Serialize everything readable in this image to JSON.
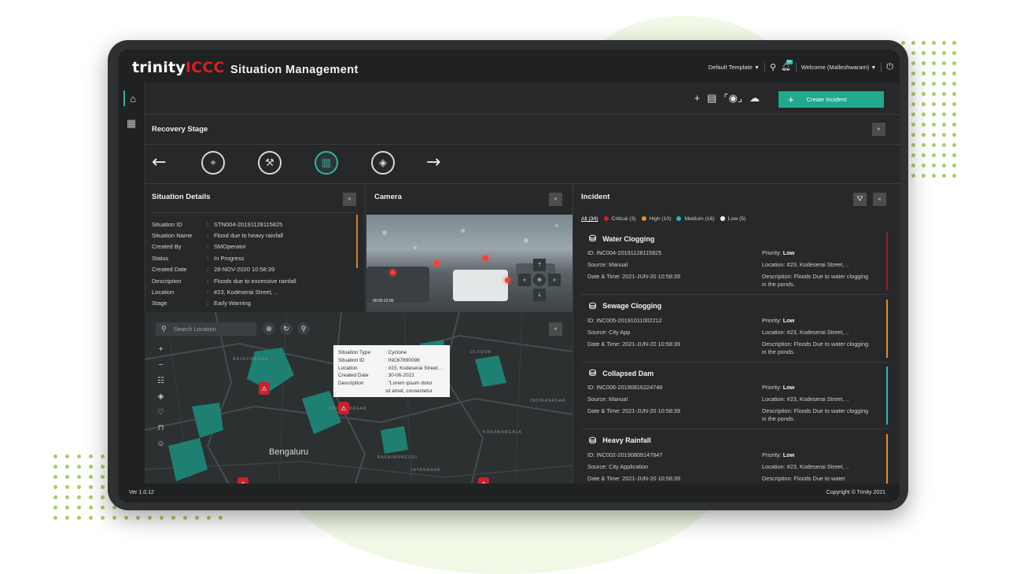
{
  "app": {
    "logo_main": "trinity",
    "logo_accent": "ICCC",
    "title": "Situation Management"
  },
  "header": {
    "template": "Default Template",
    "welcome": "Welcome (Malleshwaram)",
    "notification_badge": "9+"
  },
  "toolbar": {
    "create_label": "Create Incident"
  },
  "recovery": {
    "title": "Recovery Stage",
    "collapse_label": "«"
  },
  "situation": {
    "title": "Situation Details",
    "rows": [
      {
        "label": "Situation ID",
        "value": "STN004-20191128115825"
      },
      {
        "label": "Situation Name",
        "value": "Flood due to heavy rainfall"
      },
      {
        "label": "Created By",
        "value": "SMOperator"
      },
      {
        "label": "Status",
        "value": "In Progress"
      },
      {
        "label": "Created Date",
        "value": "28-NOV-2020 10:58:39"
      },
      {
        "label": "Description",
        "value": "Floods due to excessive rainfall"
      },
      {
        "label": "Location",
        "value": "#23, Kodeserai Street, .."
      },
      {
        "label": "Stage",
        "value": "Early Warning"
      }
    ]
  },
  "camera": {
    "title": "Camera",
    "timestamp": "00:00:12:00"
  },
  "map": {
    "search_placeholder": "Search Location",
    "city_label": "Bengaluru",
    "district_labels": [
      "Rajajinagar",
      "Shivajinagar",
      "Basavanagudi",
      "Jayanagar",
      "Indiranagar",
      "Ulsoor",
      "Koramangala"
    ],
    "tooltip": [
      {
        "label": "Situation Type",
        "value": ": Cyclone"
      },
      {
        "label": "Situation ID",
        "value": ": INC67890098"
      },
      {
        "label": "Location",
        "value": ": #23, Kodeserai Street, .."
      },
      {
        "label": "Created Date",
        "value": ": 30-06-2021"
      },
      {
        "label": "Description",
        "value": ": \"Lorem ipsum dolor"
      },
      {
        "label": "",
        "value": "sit amet, consectetur"
      }
    ]
  },
  "incident": {
    "title": "Incident",
    "filters": [
      {
        "label": "All (34)",
        "color": ""
      },
      {
        "label": "Critical (3)",
        "color": "#c9222a"
      },
      {
        "label": "High (10)",
        "color": "#e68a2e"
      },
      {
        "label": "Medium (16)",
        "color": "#2cb5c0"
      },
      {
        "label": "Low (5)",
        "color": "#ffffff"
      }
    ],
    "items": [
      {
        "title": "Water Clogging",
        "id": "ID: INC004-20191128115825",
        "source": "Source: Manual",
        "datetime": "Date & Time: 2021-JUN-20 10:58:39",
        "priority_label": "Priority:",
        "priority": "Low",
        "location": "Location:  #23, Kodeserai Street, ..",
        "description": "Description: Floods Due to water clogging in the ponds.",
        "color": "#9b1c1c"
      },
      {
        "title": "Sewage Clogging",
        "id": "ID: INC005-20191011002212",
        "source": "Source: City App",
        "datetime": "Date & Time: 2021-JUN-20 10:58:39",
        "priority_label": "Priority:",
        "priority": "Low",
        "location": "Location:  #23, Kodeserai Street, ..",
        "description": "Description: Floods Due to water clogging in the ponds.",
        "color": "#e68a2e"
      },
      {
        "title": "Collapsed Dam",
        "id": "ID: INC006-20190816224748",
        "source": "Source: Manual",
        "datetime": "Date & Time: 2021-JUN-20 10:58:39",
        "priority_label": "Priority:",
        "priority": "Low",
        "location": "Location:  #23, Kodeserai Street, ..",
        "description": "Description: Floods Due to water clogging in the ponds.",
        "color": "#2cb5c0"
      },
      {
        "title": "Heavy Rainfall",
        "id": "ID: INC002-20190809147847",
        "source": "Source: City Application",
        "datetime": "Date & Time: 2021-JUN-20 10:58:39",
        "priority_label": "Priority:",
        "priority": "Low",
        "location": "Location:  #23, Kodeserai Street, ..",
        "description": "Description: Floods Due to water",
        "color": "#e68a2e"
      }
    ]
  },
  "footer": {
    "version": "Ver 1.0.12",
    "copyright": "Copyright © Trinity 2021"
  }
}
